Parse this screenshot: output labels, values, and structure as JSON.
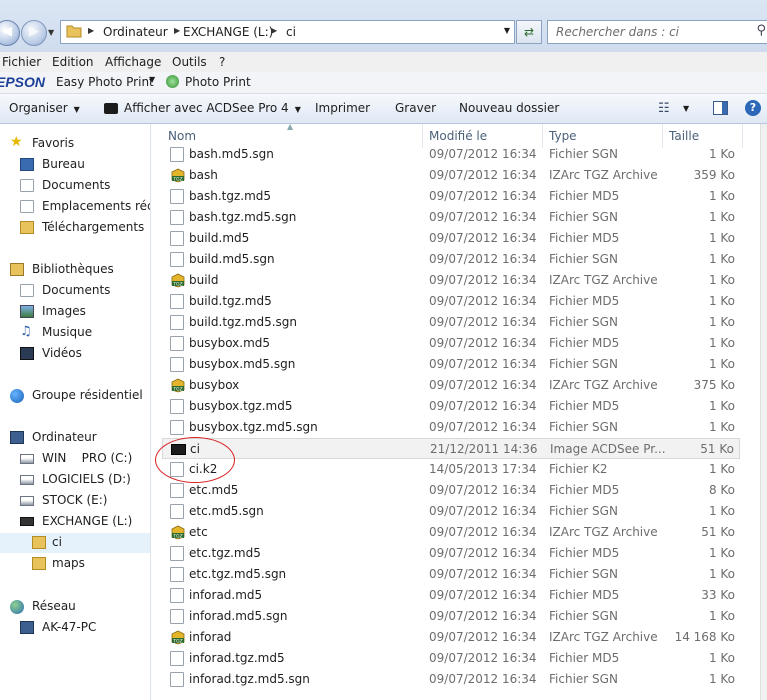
{
  "address": {
    "crumbs": [
      "Ordinateur",
      "EXCHANGE (L:)",
      "ci"
    ],
    "search_placeholder": "Rechercher dans : ci"
  },
  "menu": [
    "Fichier",
    "Edition",
    "Affichage",
    "Outils",
    "?"
  ],
  "epson": {
    "logo": "EPSON",
    "easy_photo_print": "Easy Photo Print",
    "photo_print": "Photo Print"
  },
  "toolbar": {
    "organize": "Organiser",
    "open_with": "Afficher avec ACDSee Pro 4",
    "print": "Imprimer",
    "burn": "Graver",
    "new_folder": "Nouveau dossier"
  },
  "sidebar": {
    "favorites": "Favoris",
    "fav_items": [
      "Bureau",
      "Documents",
      "Emplacements récents",
      "Téléchargements"
    ],
    "libraries": "Bibliothèques",
    "lib_items": [
      "Documents",
      "Images",
      "Musique",
      "Vidéos"
    ],
    "homegroup": "Groupe résidentiel",
    "computer": "Ordinateur",
    "drives": [
      "WIN    PRO (C:)",
      "LOGICIELS (D:)",
      "STOCK (E:)",
      "EXCHANGE (L:)"
    ],
    "folders": [
      "ci",
      "maps"
    ],
    "network": "Réseau",
    "network_items": [
      "AK-47-PC"
    ]
  },
  "columns": {
    "name": "Nom",
    "modified": "Modifié le",
    "type": "Type",
    "size": "Taille"
  },
  "files": [
    {
      "name": "bash.md5.sgn",
      "date": "09/07/2012 16:34",
      "type": "Fichier SGN",
      "size": "1 Ko",
      "icon": "doc"
    },
    {
      "name": "bash",
      "date": "09/07/2012 16:34",
      "type": "IZArc TGZ Archive",
      "size": "359 Ko",
      "icon": "tgz"
    },
    {
      "name": "bash.tgz.md5",
      "date": "09/07/2012 16:34",
      "type": "Fichier MD5",
      "size": "1 Ko",
      "icon": "doc"
    },
    {
      "name": "bash.tgz.md5.sgn",
      "date": "09/07/2012 16:34",
      "type": "Fichier SGN",
      "size": "1 Ko",
      "icon": "doc"
    },
    {
      "name": "build.md5",
      "date": "09/07/2012 16:34",
      "type": "Fichier MD5",
      "size": "1 Ko",
      "icon": "doc"
    },
    {
      "name": "build.md5.sgn",
      "date": "09/07/2012 16:34",
      "type": "Fichier SGN",
      "size": "1 Ko",
      "icon": "doc"
    },
    {
      "name": "build",
      "date": "09/07/2012 16:34",
      "type": "IZArc TGZ Archive",
      "size": "1 Ko",
      "icon": "tgz"
    },
    {
      "name": "build.tgz.md5",
      "date": "09/07/2012 16:34",
      "type": "Fichier MD5",
      "size": "1 Ko",
      "icon": "doc"
    },
    {
      "name": "build.tgz.md5.sgn",
      "date": "09/07/2012 16:34",
      "type": "Fichier SGN",
      "size": "1 Ko",
      "icon": "doc"
    },
    {
      "name": "busybox.md5",
      "date": "09/07/2012 16:34",
      "type": "Fichier MD5",
      "size": "1 Ko",
      "icon": "doc"
    },
    {
      "name": "busybox.md5.sgn",
      "date": "09/07/2012 16:34",
      "type": "Fichier SGN",
      "size": "1 Ko",
      "icon": "doc"
    },
    {
      "name": "busybox",
      "date": "09/07/2012 16:34",
      "type": "IZArc TGZ Archive",
      "size": "375 Ko",
      "icon": "tgz"
    },
    {
      "name": "busybox.tgz.md5",
      "date": "09/07/2012 16:34",
      "type": "Fichier MD5",
      "size": "1 Ko",
      "icon": "doc"
    },
    {
      "name": "busybox.tgz.md5.sgn",
      "date": "09/07/2012 16:34",
      "type": "Fichier SGN",
      "size": "1 Ko",
      "icon": "doc"
    },
    {
      "name": "ci",
      "date": "21/12/2011 14:36",
      "type": "Image ACDSee Pr...",
      "size": "51 Ko",
      "icon": "img"
    },
    {
      "name": "ci.k2",
      "date": "14/05/2013 17:34",
      "type": "Fichier K2",
      "size": "1 Ko",
      "icon": "doc"
    },
    {
      "name": "etc.md5",
      "date": "09/07/2012 16:34",
      "type": "Fichier MD5",
      "size": "8 Ko",
      "icon": "doc"
    },
    {
      "name": "etc.md5.sgn",
      "date": "09/07/2012 16:34",
      "type": "Fichier SGN",
      "size": "1 Ko",
      "icon": "doc"
    },
    {
      "name": "etc",
      "date": "09/07/2012 16:34",
      "type": "IZArc TGZ Archive",
      "size": "51 Ko",
      "icon": "tgz"
    },
    {
      "name": "etc.tgz.md5",
      "date": "09/07/2012 16:34",
      "type": "Fichier MD5",
      "size": "1 Ko",
      "icon": "doc"
    },
    {
      "name": "etc.tgz.md5.sgn",
      "date": "09/07/2012 16:34",
      "type": "Fichier SGN",
      "size": "1 Ko",
      "icon": "doc"
    },
    {
      "name": "inforad.md5",
      "date": "09/07/2012 16:34",
      "type": "Fichier MD5",
      "size": "33 Ko",
      "icon": "doc"
    },
    {
      "name": "inforad.md5.sgn",
      "date": "09/07/2012 16:34",
      "type": "Fichier SGN",
      "size": "1 Ko",
      "icon": "doc"
    },
    {
      "name": "inforad",
      "date": "09/07/2012 16:34",
      "type": "IZArc TGZ Archive",
      "size": "14 168 Ko",
      "icon": "tgz"
    },
    {
      "name": "inforad.tgz.md5",
      "date": "09/07/2012 16:34",
      "type": "Fichier MD5",
      "size": "1 Ko",
      "icon": "doc"
    },
    {
      "name": "inforad.tgz.md5.sgn",
      "date": "09/07/2012 16:34",
      "type": "Fichier SGN",
      "size": "1 Ko",
      "icon": "doc"
    }
  ]
}
